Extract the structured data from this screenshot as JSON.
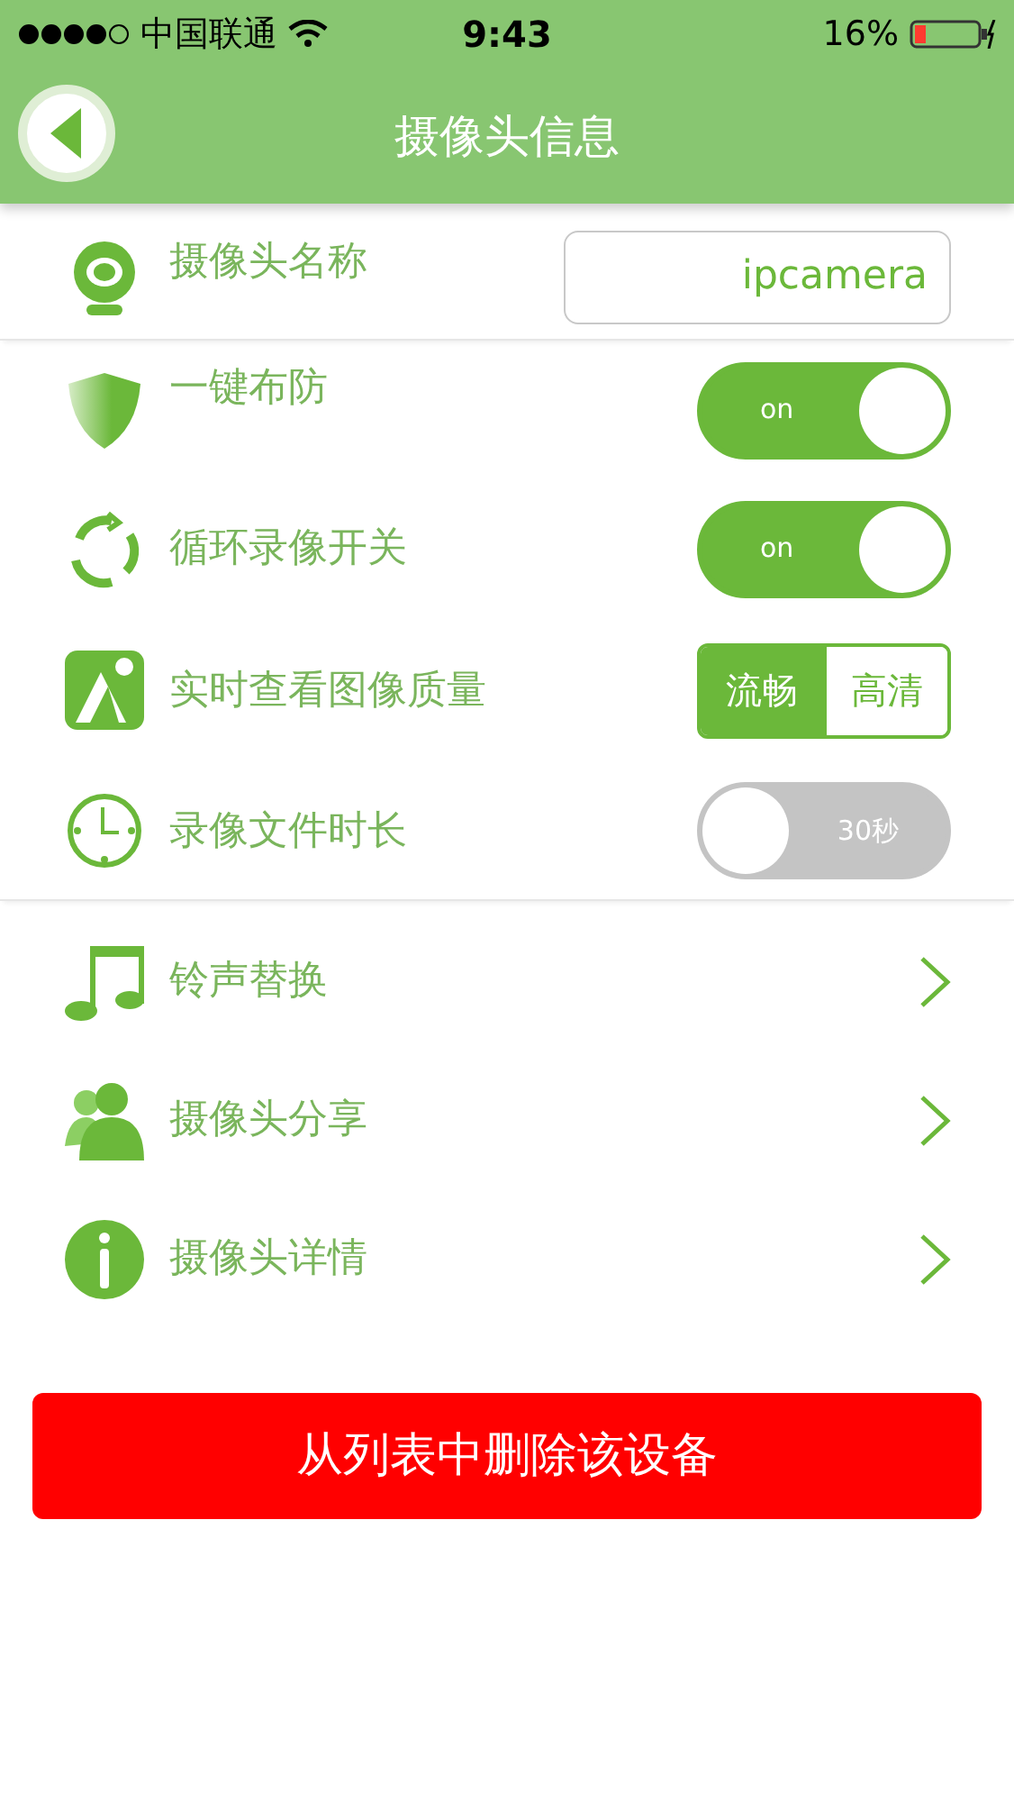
{
  "status_bar": {
    "carrier": "中国联通",
    "time": "9:43",
    "battery": "16%"
  },
  "nav": {
    "title": "摄像头信息"
  },
  "settings": [
    {
      "kind": "field",
      "label": "摄像头名称",
      "value": "ipcamera"
    },
    {
      "kind": "toggle",
      "label": "一键布防",
      "on": true,
      "text": "on"
    },
    {
      "kind": "toggle",
      "label": "循环录像开关",
      "on": true,
      "text": "on"
    },
    {
      "kind": "segmented",
      "label": "实时查看图像质量",
      "options": [
        {
          "label": "流畅",
          "selected": true
        },
        {
          "label": "高清",
          "selected": false
        }
      ]
    },
    {
      "kind": "toggle",
      "label": "录像文件时长",
      "on": false,
      "text": "30秒"
    }
  ],
  "links": [
    {
      "label": "铃声替换"
    },
    {
      "label": "摄像头分享"
    },
    {
      "label": "摄像头详情"
    }
  ],
  "delete_button": "从列表中删除该设备"
}
